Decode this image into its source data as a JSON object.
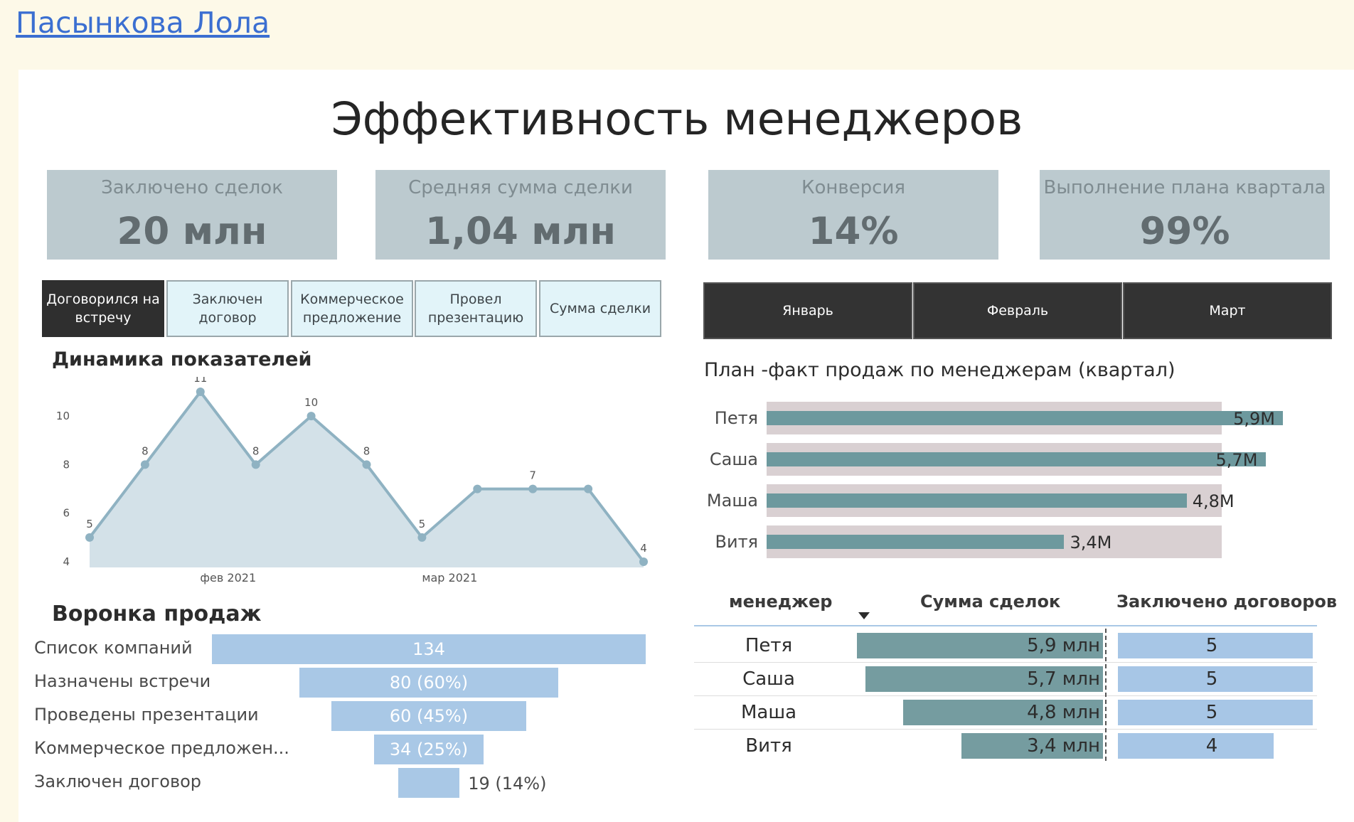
{
  "author": "Пасынкова Лола",
  "title": "Эффективность менеджеров",
  "kpis": [
    {
      "label": "Заключено сделок",
      "value": "20 млн"
    },
    {
      "label": "Средняя сумма сделки",
      "value": "1,04 млн"
    },
    {
      "label": "Конверсия",
      "value": "14%"
    },
    {
      "label": "Выполнение плана квартала",
      "value": "99%"
    }
  ],
  "metric_buttons": [
    "Договорился на встречу",
    "Заключен договор",
    "Коммерческое предложение",
    "Провел презентацию",
    "Сумма сделки"
  ],
  "month_buttons": [
    "Январь",
    "Февраль",
    "Март"
  ],
  "colors": {
    "accent": "#6d999e",
    "area_fill": "#d3e1e8",
    "line": "#8fb2c2",
    "funnel": "#a9c8e6",
    "kpi_bg": "#bccacf",
    "plan_bg": "#d9d0d2"
  },
  "chart_data": [
    {
      "type": "area",
      "title": "Динамика показателей",
      "x_tick_labels": [
        "фев 2021",
        "мар 2021"
      ],
      "y_ticks": [
        "4",
        "6",
        "8",
        "10"
      ],
      "values": [
        5,
        8,
        11,
        8,
        10,
        8,
        5,
        7,
        7,
        7,
        4
      ],
      "data_labels": [
        "5",
        "8",
        "11",
        "8",
        "10",
        "8",
        "5",
        "",
        "7",
        "",
        "4"
      ],
      "ylim": [
        4,
        11
      ]
    },
    {
      "type": "bar",
      "title": "Воронка продаж",
      "categories": [
        "Список компаний",
        "Назначены встречи",
        "Проведены презентации",
        "Коммерческое предложен...",
        "Заключен договор"
      ],
      "values": [
        134,
        80,
        60,
        34,
        19
      ],
      "data_labels": [
        "134",
        "80 (60%)",
        "60 (45%)",
        "34 (25%)",
        "19 (14%)"
      ]
    },
    {
      "type": "bar",
      "title": "План -факт продаж по менеджерам (квартал)",
      "categories": [
        "Петя",
        "Саша",
        "Маша",
        "Витя"
      ],
      "values": [
        5.9,
        5.7,
        4.8,
        3.4
      ],
      "plan": 5.2,
      "data_labels": [
        "5,9M",
        "5,7M",
        "4,8M",
        "3,4M"
      ]
    }
  ],
  "table": {
    "headers": [
      "менеджер",
      "Сумма сделок",
      "Заключено договоров"
    ],
    "rows": [
      {
        "name": "Петя",
        "sum": "5,9 млн",
        "sum_value": 5.9,
        "count": "5",
        "count_value": 5
      },
      {
        "name": "Саша",
        "sum": "5,7 млн",
        "sum_value": 5.7,
        "count": "5",
        "count_value": 5
      },
      {
        "name": "Маша",
        "sum": "4,8 млн",
        "sum_value": 4.8,
        "count": "5",
        "count_value": 5
      },
      {
        "name": "Витя",
        "sum": "3,4 млн",
        "sum_value": 3.4,
        "count": "4",
        "count_value": 4
      }
    ]
  }
}
